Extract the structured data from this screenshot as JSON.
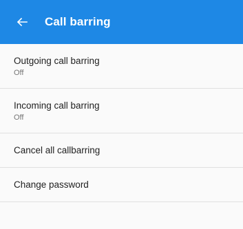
{
  "toolbar": {
    "title": "Call barring",
    "back_icon": "arrow-back-icon",
    "color": "#1e88e5"
  },
  "items": [
    {
      "label": "Outgoing call barring",
      "summary": "Off"
    },
    {
      "label": "Incoming call barring",
      "summary": "Off"
    },
    {
      "label": "Cancel all callbarring"
    },
    {
      "label": "Change password"
    }
  ]
}
